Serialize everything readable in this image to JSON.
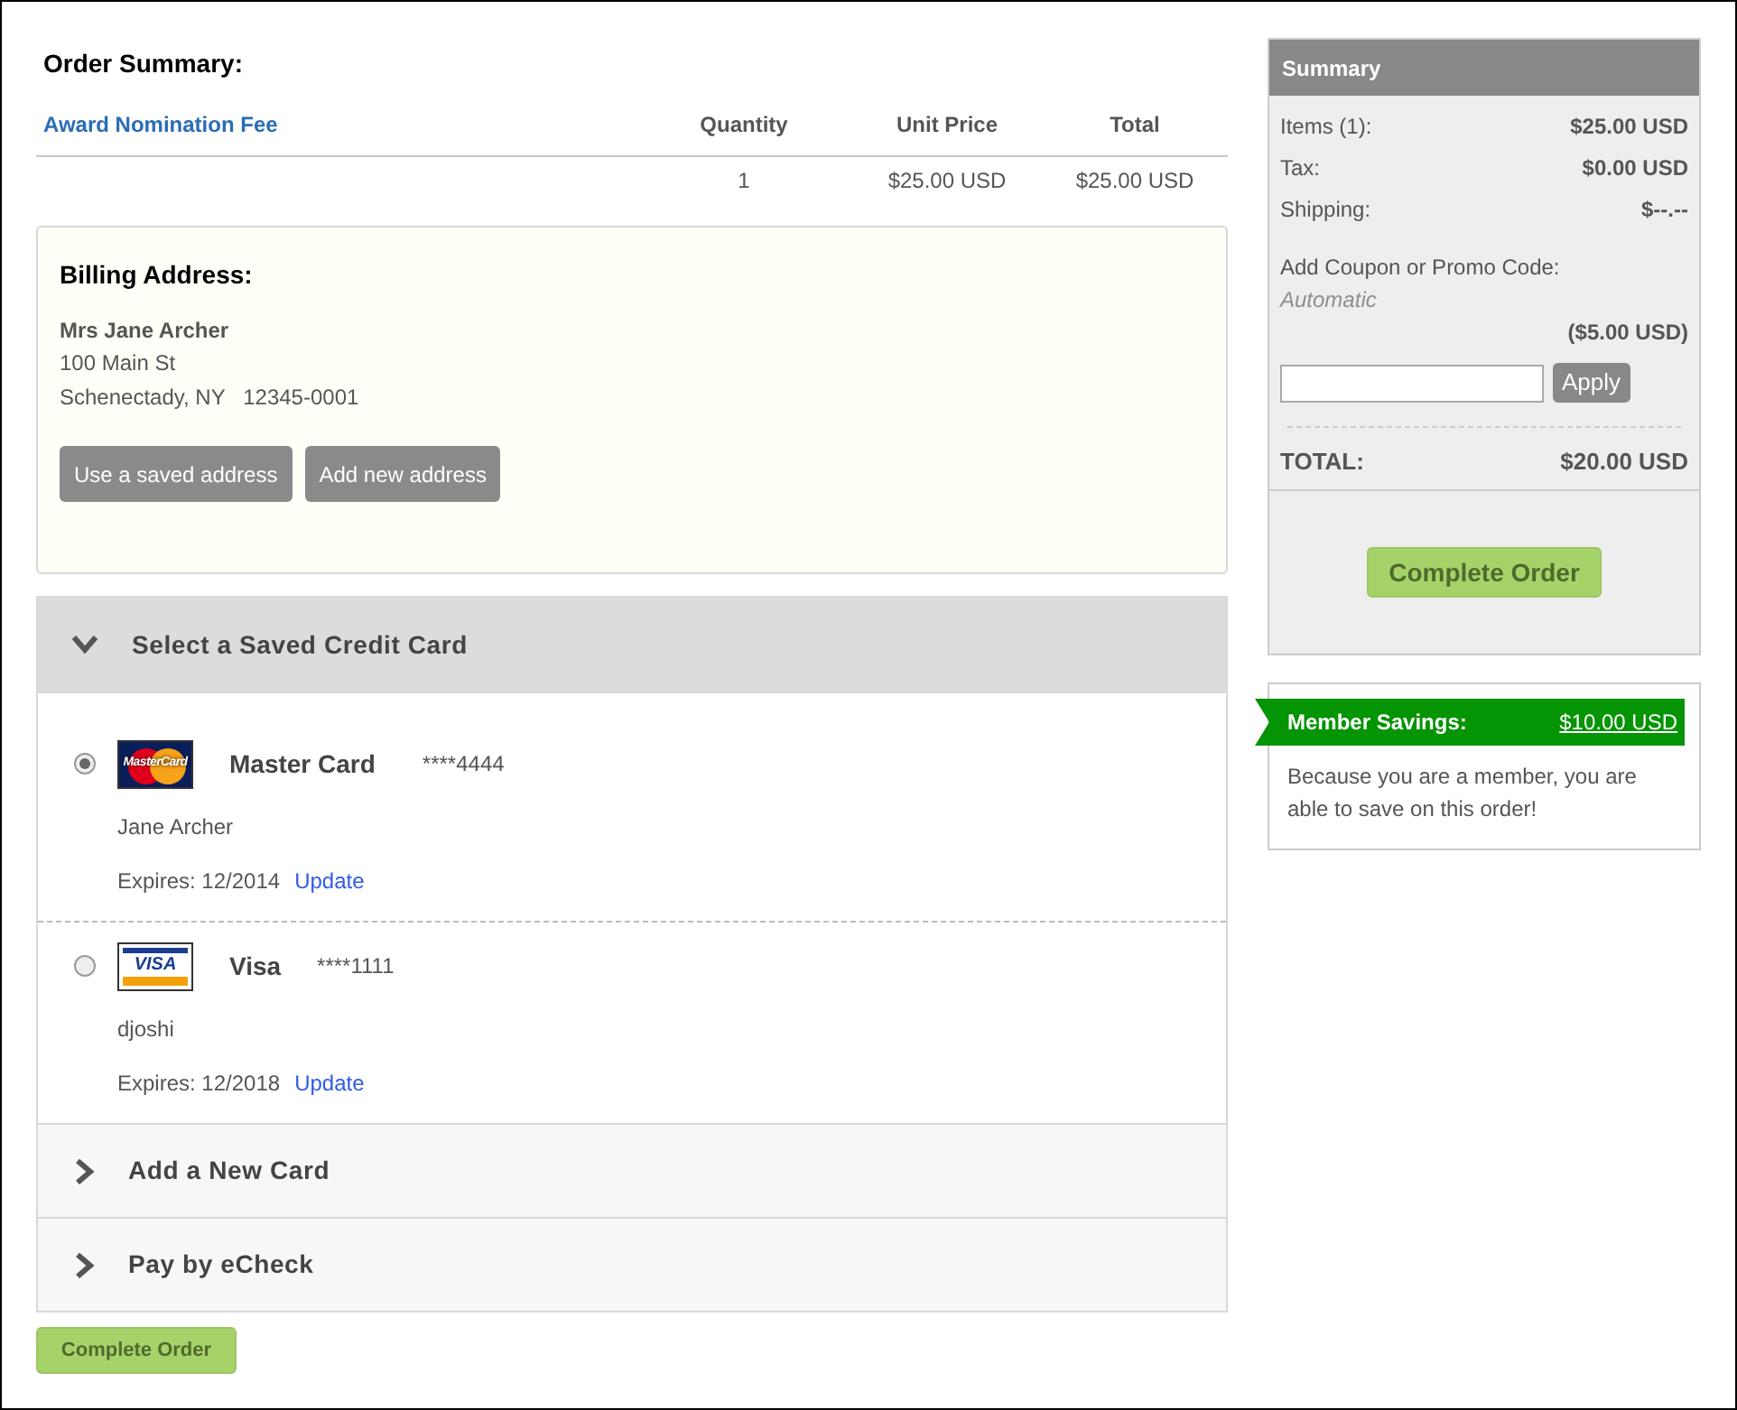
{
  "order_summary": {
    "title": "Order Summary:",
    "columns": [
      "Award Nomination Fee",
      "Quantity",
      "Unit Price",
      "Total"
    ],
    "rows": [
      {
        "quantity": "1",
        "unit_price": "$25.00 USD",
        "total": "$25.00 USD"
      }
    ]
  },
  "billing_address": {
    "title": "Billing Address:",
    "name": "Mrs Jane Archer",
    "street": "100 Main St",
    "city_line": "Schenectady, NY   12345-0001",
    "buttons": [
      "Use a saved address",
      "Add new address"
    ]
  },
  "payment_sections": [
    {
      "title": "Select a Saved Credit Card",
      "expanded": true,
      "cards": [
        {
          "kind": "mastercard",
          "logo_text": "MasterCard",
          "name": "Master Card",
          "number": "****4444",
          "holder": "Jane Archer",
          "expires": "Expires: 12/2014",
          "link": "Update",
          "selected": true
        },
        {
          "kind": "visa",
          "logo_text": "VISA",
          "name": "Visa",
          "number": "****1111",
          "holder": "djoshi",
          "expires": "Expires: 12/2018",
          "link": "Update",
          "selected": false
        }
      ]
    },
    {
      "title": "Add a New Card",
      "expanded": false
    },
    {
      "title": "Pay by eCheck",
      "expanded": false
    }
  ],
  "complete_button": "Complete Order",
  "summary": {
    "title": "Summary",
    "lines": [
      {
        "label": "Items (1):",
        "value": "$25.00 USD"
      },
      {
        "label": "Tax:",
        "value": "$0.00 USD"
      },
      {
        "label": "Shipping:",
        "value": "$--.--"
      }
    ],
    "coupon_label": "Add Coupon or Promo Code:",
    "coupon_note": "Automatic",
    "discount": "($5.00 USD)",
    "apply_button": "Apply",
    "total_label": "TOTAL:",
    "total_value": "$20.00 USD",
    "complete_button": "Complete Order"
  },
  "member_savings": {
    "label": "Member Savings:",
    "amount": "$10.00 USD",
    "text": "Because you are a member, you are able to save on this order!"
  }
}
